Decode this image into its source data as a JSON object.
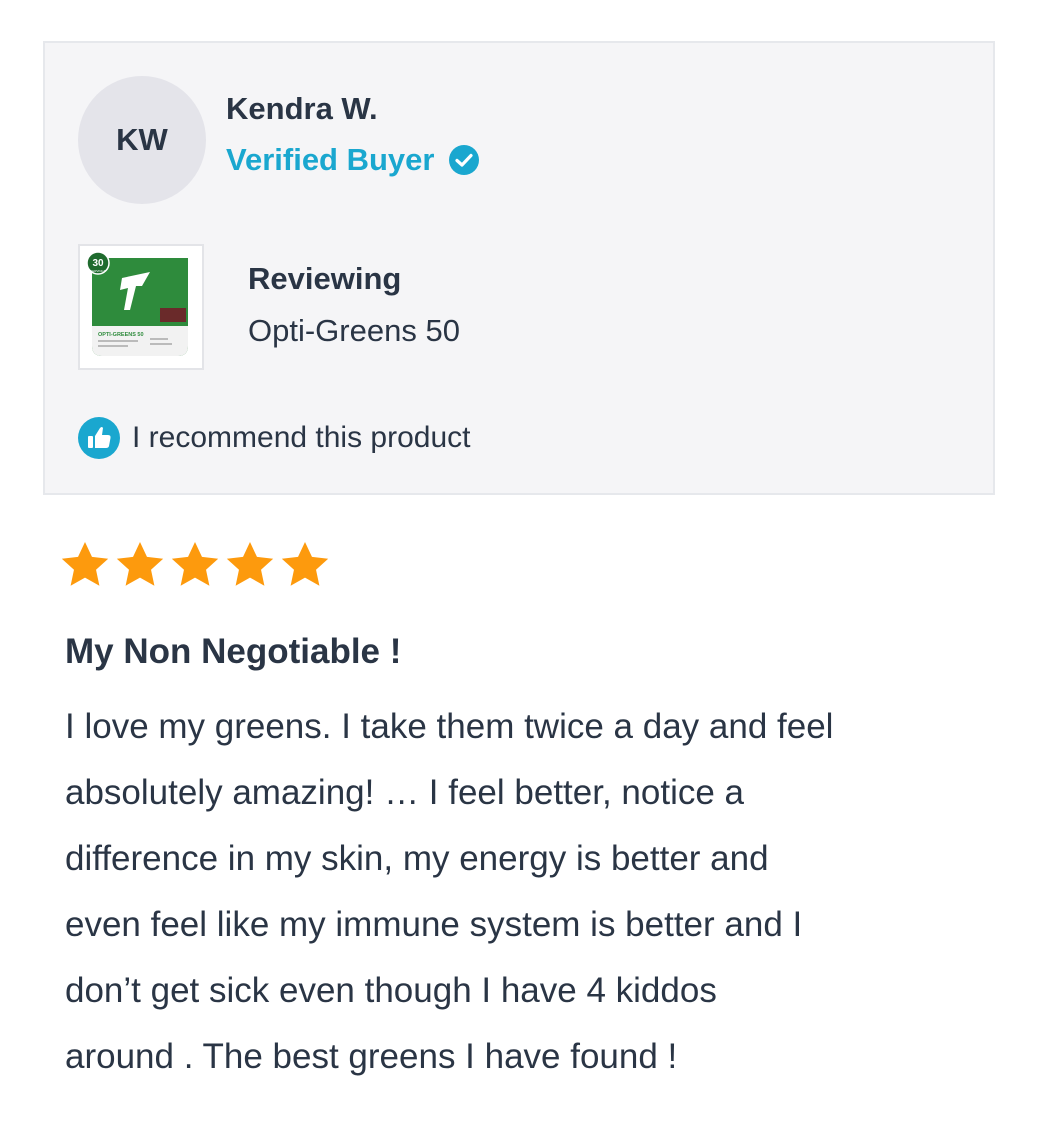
{
  "reviewer": {
    "initials": "KW",
    "name": "Kendra W.",
    "badge": "Verified Buyer",
    "badge_icon": "verified-check-icon"
  },
  "product": {
    "reviewing_label": "Reviewing",
    "name": "Opti-Greens 50",
    "thumbnail": {
      "servings_badge": "30",
      "servings_label": "SERVINGS",
      "package_text": "OPTI-GREENS 50"
    }
  },
  "recommend": {
    "icon": "thumbs-up-icon",
    "text": "I recommend this product"
  },
  "rating": {
    "value": 5,
    "max": 5
  },
  "review": {
    "title": "My Non Negotiable !",
    "lines": [
      "I love my greens. I take them twice a day and feel",
      "absolutely amazing! … I feel better, notice a",
      "difference in my skin, my energy is better and",
      "even feel like my immune system is better and I",
      "don’t get sick even though I have 4 kiddos",
      "around . The best greens I have found !"
    ]
  },
  "colors": {
    "accent": "#1aa7cf",
    "star": "#fd9a0d",
    "text": "#2a3545",
    "card_bg": "#f5f5f7",
    "package_green": "#2e8b3c"
  }
}
